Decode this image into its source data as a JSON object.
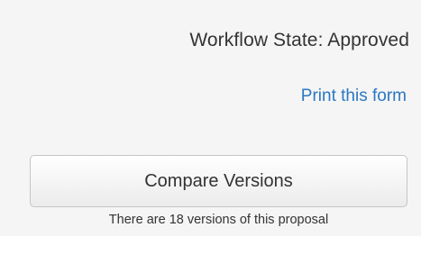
{
  "workflow": {
    "label": "Workflow State: Approved"
  },
  "actions": {
    "print_label": "Print this form",
    "compare_label": "Compare Versions"
  },
  "versions_note": "There are 18 versions of this proposal",
  "colors": {
    "panel_background": "#f5f5f5",
    "link": "#2a78c2",
    "text": "#333333"
  }
}
